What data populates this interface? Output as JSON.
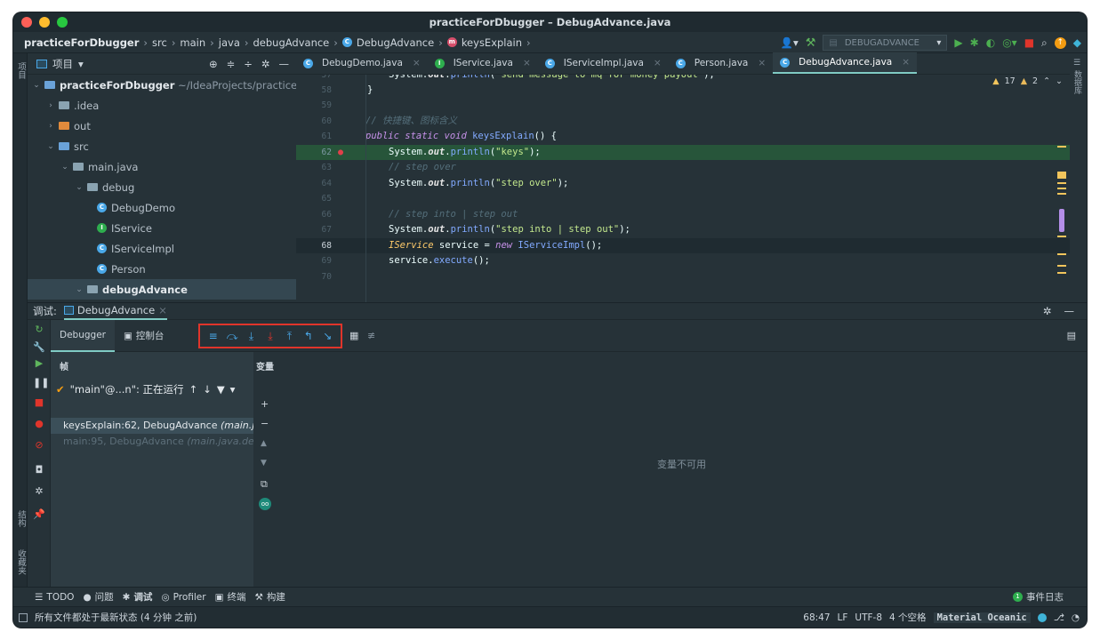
{
  "window": {
    "title": "practiceForDbugger – DebugAdvance.java"
  },
  "breadcrumb": {
    "project": "practiceForDbugger",
    "items": [
      "src",
      "main",
      "java",
      "debugAdvance",
      "DebugAdvance",
      "keysExplain"
    ]
  },
  "toolbar": {
    "run_config": "DEBUGADVANCE"
  },
  "left_strip": {
    "project_tab": "项目",
    "structure_tab": "结构",
    "favorites_tab": "收藏夹"
  },
  "project_panel": {
    "header": "项目",
    "tree": [
      {
        "label": "practiceForDbugger",
        "suffix": "~/IdeaProjects/practiceForDb",
        "expanded": true
      },
      {
        "label": ".idea",
        "expanded": false
      },
      {
        "label": "out",
        "expanded": false
      },
      {
        "label": "src",
        "expanded": true
      },
      {
        "label": "main.java",
        "expanded": true
      },
      {
        "label": "debug",
        "expanded": true
      },
      {
        "label": "DebugDemo"
      },
      {
        "label": "IService"
      },
      {
        "label": "IServiceImpl"
      },
      {
        "label": "Person"
      },
      {
        "label": "debugAdvance",
        "expanded": true
      }
    ]
  },
  "editor_tabs": [
    "DebugDemo.java",
    "IService.java",
    "IServiceImpl.java",
    "Person.java",
    "DebugAdvance.java"
  ],
  "editor": {
    "inspections": {
      "warnings": "17",
      "weak_warnings": "2"
    },
    "lines": [
      {
        "n": "57",
        "text": "System.out.println(\"send message to mq for money payout\");"
      },
      {
        "n": "58",
        "text": "}"
      },
      {
        "n": "59",
        "text": ""
      },
      {
        "n": "60",
        "text": "// 快捷键、图标含义"
      },
      {
        "n": "61",
        "text": "public static void keysExplain() {"
      },
      {
        "n": "62",
        "text": "System.out.println(\"keys\");"
      },
      {
        "n": "63",
        "text": "// step over"
      },
      {
        "n": "64",
        "text": "System.out.println(\"step over\");"
      },
      {
        "n": "65",
        "text": ""
      },
      {
        "n": "66",
        "text": "// step into | step out"
      },
      {
        "n": "67",
        "text": "System.out.println(\"step into | step out\");"
      },
      {
        "n": "68",
        "text": "IService service = new IServiceImpl();"
      },
      {
        "n": "69",
        "text": "service.execute();"
      },
      {
        "n": "70",
        "text": ""
      }
    ]
  },
  "debug": {
    "label": "调试:",
    "session": "DebugAdvance",
    "tabs": [
      "Debugger",
      "控制台"
    ],
    "frames_header": "帧",
    "vars_header": "变量",
    "thread": "\"main\"@...n\": 正在运行",
    "frames": [
      {
        "text": "keysExplain:62, DebugAdvance",
        "italic": "(main.jav"
      },
      {
        "text": "main:95, DebugAdvance",
        "italic": "(main.java.debu"
      }
    ],
    "vars_empty": "变量不可用"
  },
  "bottom_tabs": [
    "TODO",
    "问题",
    "调试",
    "Profiler",
    "终端",
    "构建"
  ],
  "event_log": {
    "count": "1",
    "label": "事件日志"
  },
  "status": {
    "message": "所有文件都处于最新状态 (4 分钟 之前)",
    "position": "68:47",
    "line_sep": "LF",
    "encoding": "UTF-8",
    "indent": "4 个空格",
    "theme": "Material Oceanic"
  },
  "colors": {
    "accent": "#80cbc4",
    "highlight_line": "#27553a",
    "bg": "#263238",
    "red_box": "#e0352b"
  }
}
